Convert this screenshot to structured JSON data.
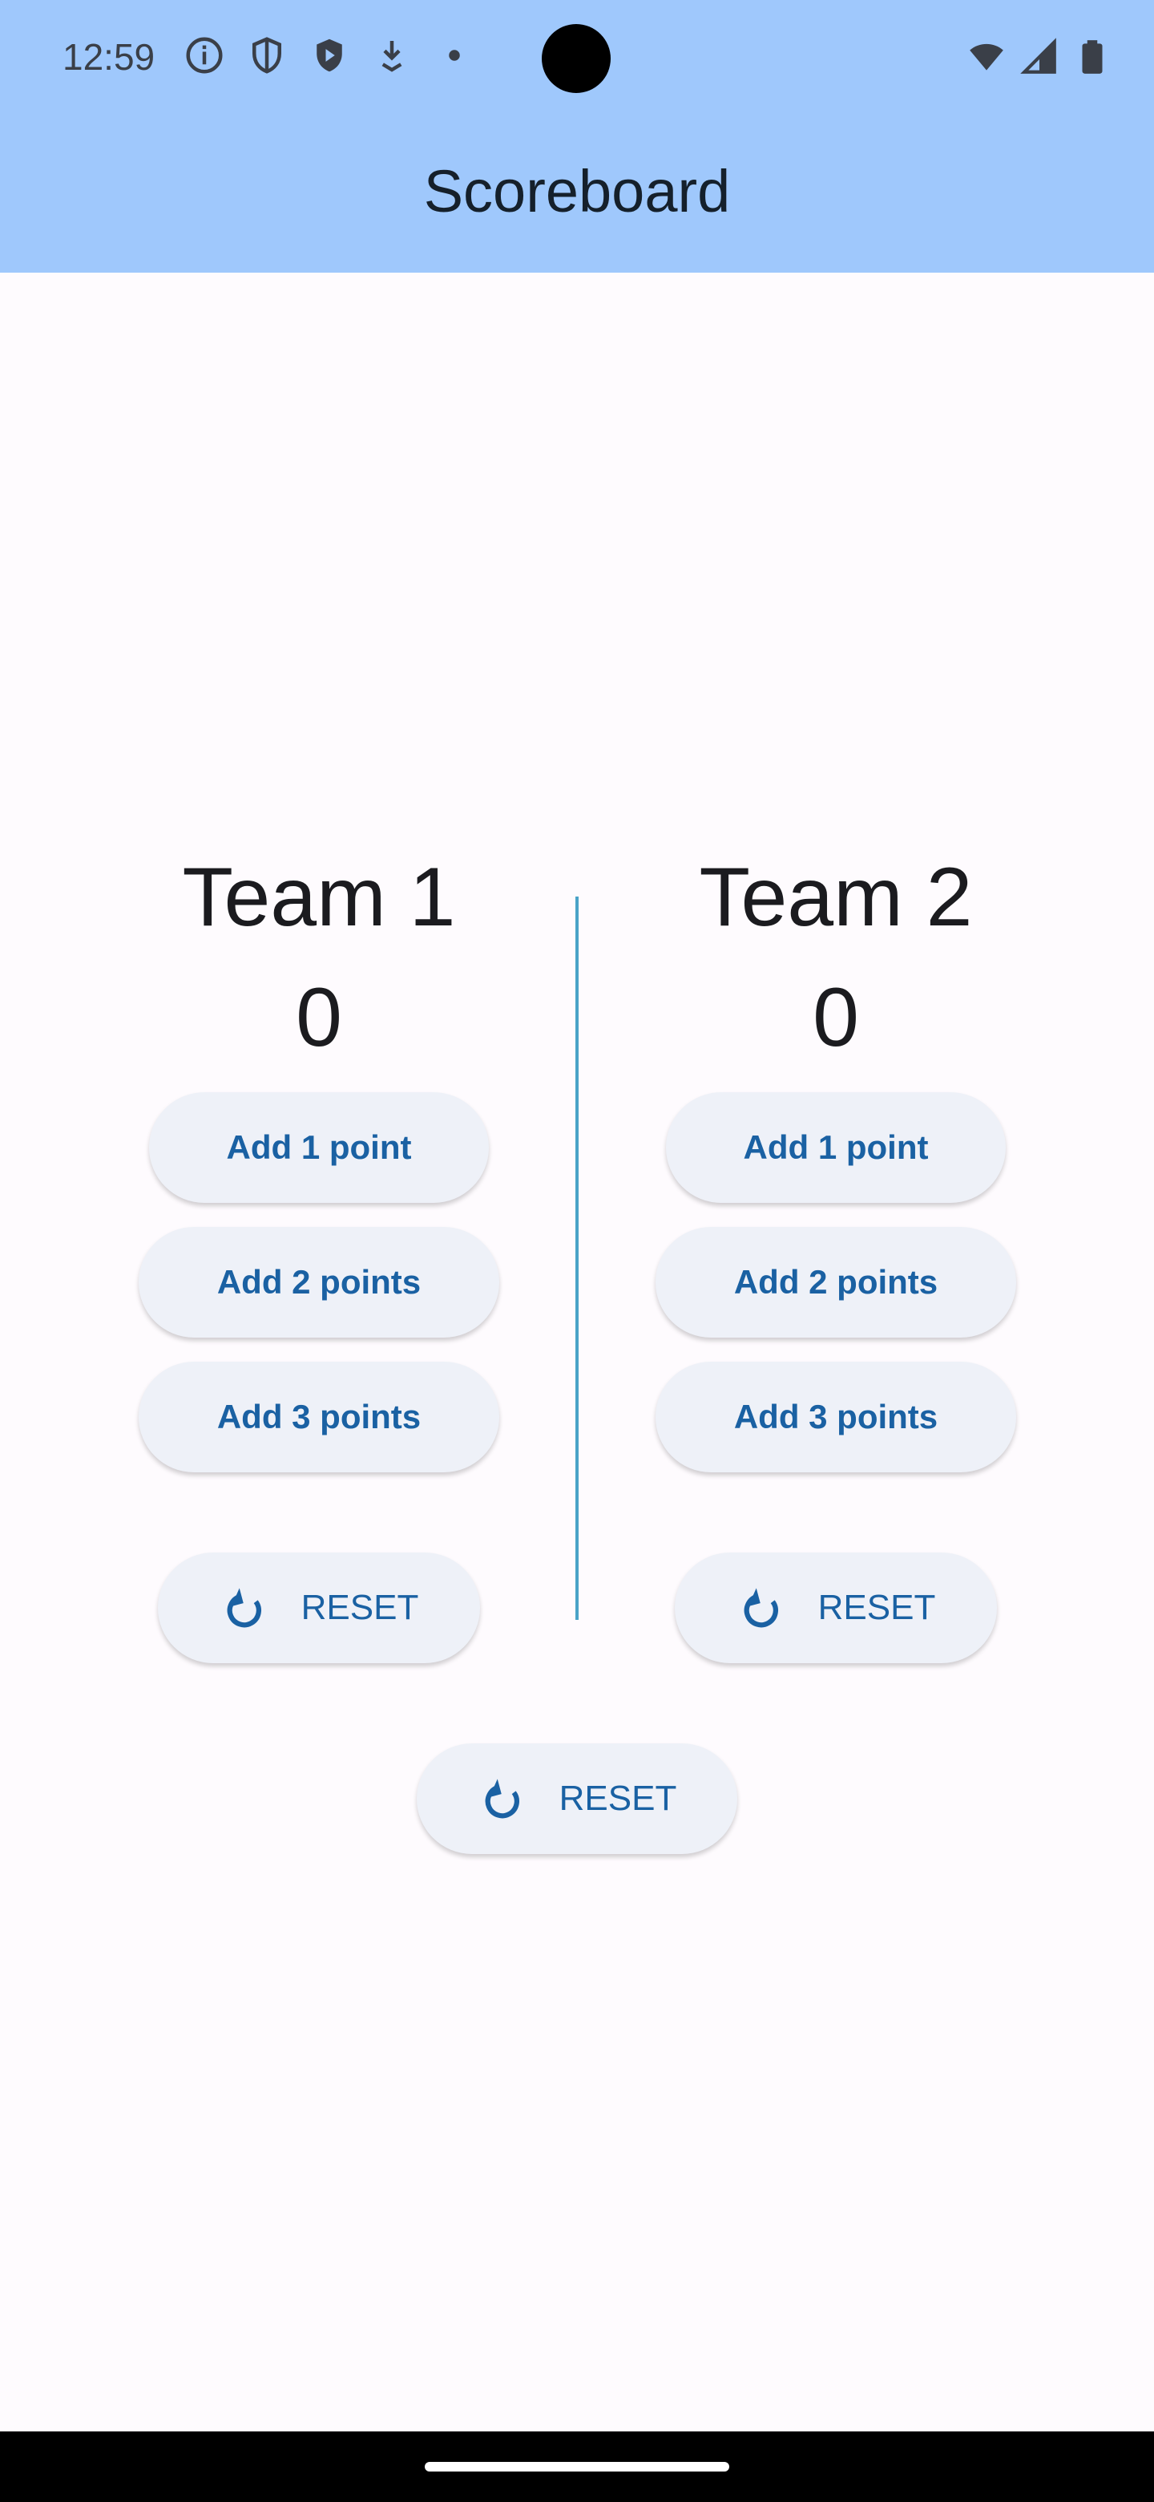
{
  "status_bar": {
    "time": "12:59",
    "left_icons": [
      "info-icon",
      "shield-outline-icon",
      "shield-play-icon",
      "download-icon",
      "dot-icon"
    ],
    "right_icons": [
      "wifi-icon",
      "signal-icon",
      "battery-icon"
    ]
  },
  "app_bar": {
    "title": "Scoreboard",
    "color": "#9fc8fc"
  },
  "teams": [
    {
      "name": "Team 1",
      "score": "0",
      "buttons": {
        "add1": "Add 1 point",
        "add2": "Add 2 points",
        "add3": "Add 3 points",
        "reset": "RESET"
      }
    },
    {
      "name": "Team 2",
      "score": "0",
      "buttons": {
        "add1": "Add 1 point",
        "add2": "Add 2 points",
        "add3": "Add 3 points",
        "reset": "RESET"
      }
    }
  ],
  "global_reset": {
    "label": "RESET",
    "icon": "refresh-icon"
  },
  "colors": {
    "accent": "#1a61a3",
    "button_bg": "#eef1f8",
    "divider": "#4aa3c8"
  }
}
